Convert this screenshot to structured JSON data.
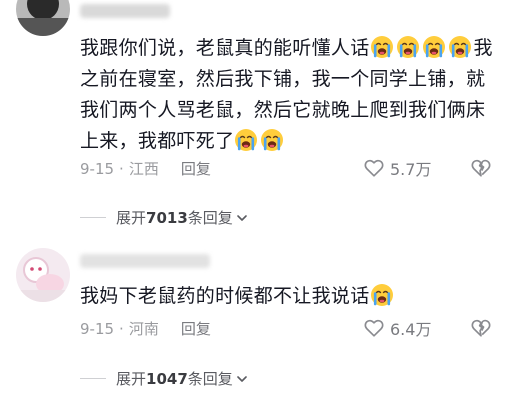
{
  "comments": [
    {
      "text_parts": [
        "我跟你们说，老鼠真的能听懂人话",
        "我之前在寝室，然后我下铺，我一个同学上铺，就我们两个人骂老鼠，然后它就晚上爬到我们俩床上来，我都吓死了"
      ],
      "date": "9-15",
      "dot": "·",
      "location": "江西",
      "reply_label": "回复",
      "likes": "5.7万",
      "expand_prefix": "展开",
      "expand_count": "7013",
      "expand_suffix": "条回复",
      "expand_icon": "chevron-down-icon",
      "emoji": "crying-face-icon"
    },
    {
      "text_parts": [
        "我妈下老鼠药的时候都不让我说话"
      ],
      "date": "9-15",
      "dot": "·",
      "location": "河南",
      "reply_label": "回复",
      "likes": "6.4万",
      "expand_prefix": "展开",
      "expand_count": "1047",
      "expand_suffix": "条回复",
      "expand_icon": "chevron-down-icon",
      "emoji": "crying-face-icon"
    }
  ],
  "colors": {
    "text": "#161823",
    "meta": "#9a9b9f",
    "emoji_face": "#ffcd3c",
    "emoji_tear": "#4aa3f0"
  },
  "icons": [
    "heart-outline-icon",
    "broken-heart-icon",
    "chevron-down-icon",
    "crying-face-icon"
  ]
}
